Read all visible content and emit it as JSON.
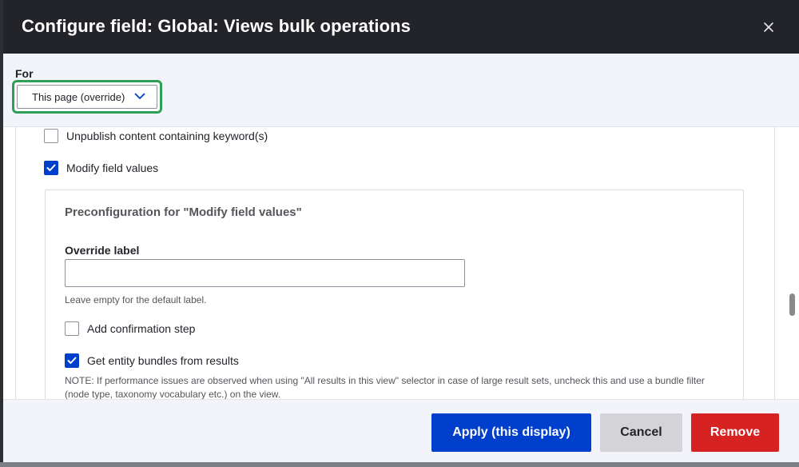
{
  "dialog": {
    "title": "Configure field: Global: Views bulk operations",
    "close_symbol": "×"
  },
  "for_section": {
    "label": "For",
    "selected": "This page (override)"
  },
  "actions": [
    {
      "label": "Unpublish content containing keyword(s)",
      "checked": false
    },
    {
      "label": "Modify field values",
      "checked": true
    }
  ],
  "preconfig": {
    "title": "Preconfiguration for \"Modify field values\"",
    "override_label": "Override label",
    "override_value": "",
    "override_description": "Leave empty for the default label.",
    "confirmation_label": "Add confirmation step",
    "confirmation_checked": false,
    "bundles_label": "Get entity bundles from results",
    "bundles_checked": true,
    "bundles_note": "NOTE: If performance issues are observed when using \"All results in this view\" selector in case of large result sets, uncheck this and use a bundle filter (node type, taxonomy vocabulary etc.) on the view."
  },
  "footer": {
    "apply_label": "Apply (this display)",
    "cancel_label": "Cancel",
    "remove_label": "Remove"
  },
  "colors": {
    "primary": "#003ecc",
    "danger": "#d72222",
    "focus_ring": "#2f9e56",
    "titlebar": "#232429"
  }
}
